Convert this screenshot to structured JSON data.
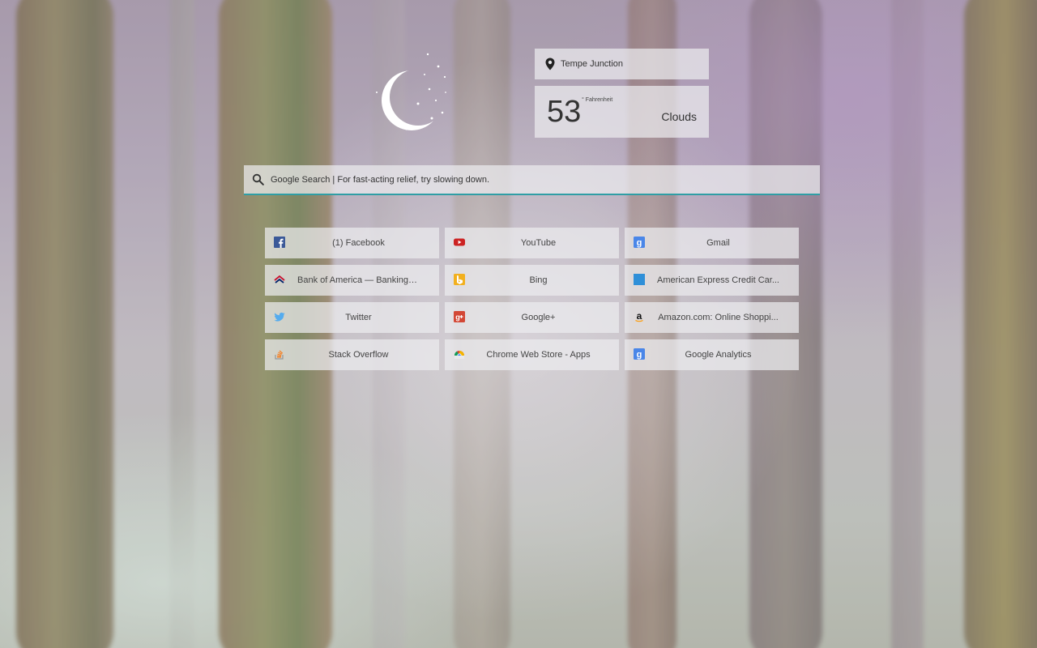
{
  "location": {
    "name": "Tempe Junction",
    "icon": "map-pin-icon"
  },
  "weather": {
    "temperature": "53",
    "unit": "° Fahrenheit",
    "condition": "Clouds",
    "icon": "crescent-moon-icon"
  },
  "search": {
    "placeholder": "Google Search | For fast-acting relief, try slowing down.",
    "icon": "search-icon",
    "accent_color": "#2f9ea5"
  },
  "tiles": [
    {
      "label": "(1) Facebook",
      "icon": "facebook-icon"
    },
    {
      "label": "YouTube",
      "icon": "youtube-icon"
    },
    {
      "label": "Gmail",
      "icon": "google-icon"
    },
    {
      "label": "Bank of America — Banking, ...",
      "icon": "bank-of-america-icon"
    },
    {
      "label": "Bing",
      "icon": "bing-icon"
    },
    {
      "label": "American Express Credit Car...",
      "icon": "american-express-icon"
    },
    {
      "label": "Twitter",
      "icon": "twitter-icon"
    },
    {
      "label": "Google+",
      "icon": "google-plus-icon"
    },
    {
      "label": "Amazon.com: Online Shoppi...",
      "icon": "amazon-icon"
    },
    {
      "label": "Stack Overflow",
      "icon": "stack-overflow-icon"
    },
    {
      "label": "Chrome Web Store - Apps",
      "icon": "chrome-web-store-icon"
    },
    {
      "label": "Google Analytics",
      "icon": "google-icon"
    }
  ]
}
